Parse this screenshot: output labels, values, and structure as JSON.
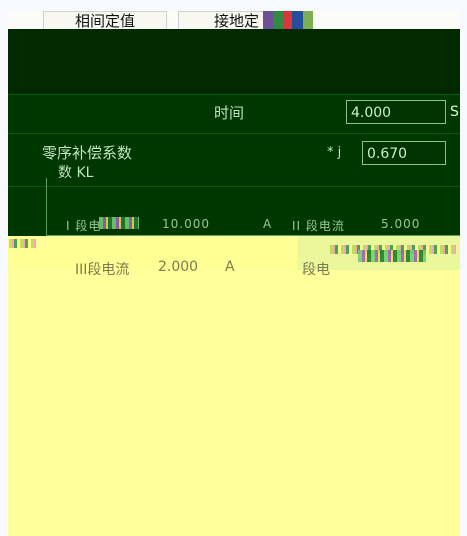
{
  "tabs": [
    {
      "label": "相间定值"
    },
    {
      "label": "接地定"
    }
  ],
  "fields": {
    "time_label": "时间",
    "time_value": "4.000",
    "time_unit": "S",
    "compensation_label": "零序补偿系数",
    "compensation_note": "数 KL",
    "compensation_value": "0.670",
    "compensation_sep": "* j",
    "current_1_prefix": "I 段电",
    "current_1_value": "10.000",
    "current_1_unit": "A",
    "current_2_label": "II 段电流",
    "current_2_value": "5.000",
    "iii_label": "III段电流",
    "iii_value": "2.000",
    "iii_unit": "A",
    "iii_tail": "段电"
  },
  "colors": {
    "dark_green": "#003700",
    "dark_green_2": "#002900",
    "yellow": "#ffff9b",
    "text_green": "#b6efb8"
  }
}
